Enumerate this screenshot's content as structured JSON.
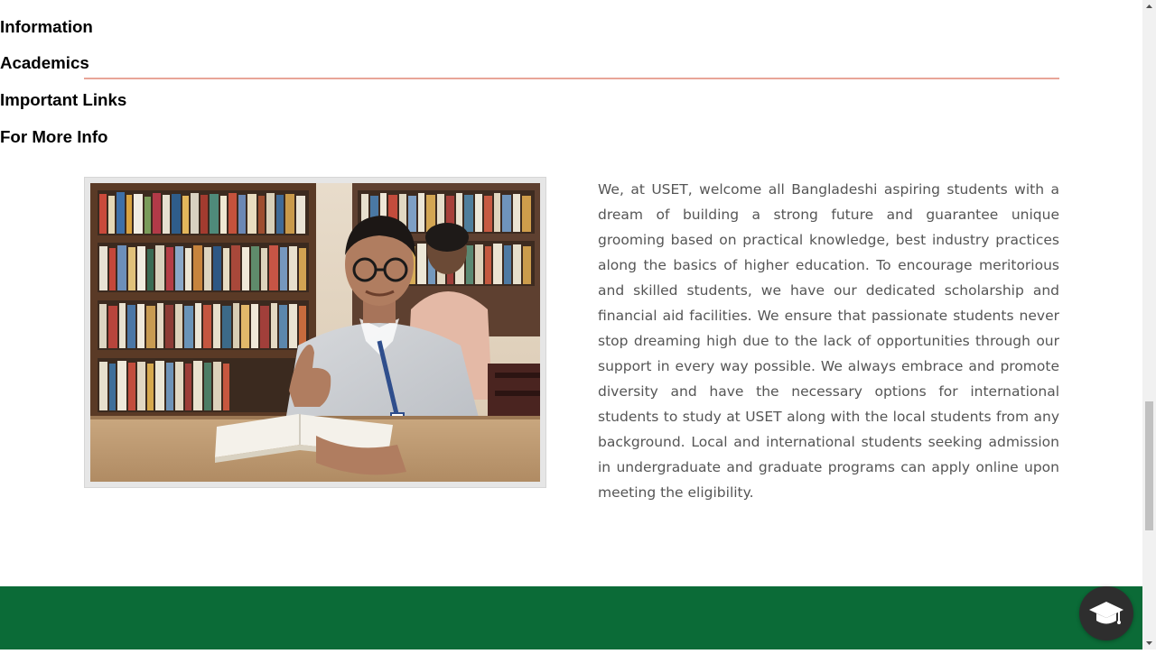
{
  "about": {
    "image_alt": "Student with book in library",
    "paragraph": "We, at USET, welcome all Bangladeshi aspiring students with a dream of building a strong future and guarantee unique grooming based on practical knowledge, best industry practices along the basics of higher education. To encourage meritorious and skilled students, we have our dedicated scholarship and financial aid facilities. We ensure that passionate students never stop dreaming high due to the lack of opportunities through our support in every way possible. We always embrace and promote diversity and have the necessary options for international students to study at USET along with the local students from any background. Local and international students seeking admission in undergraduate and graduate programs can apply online upon meeting the eligibility."
  },
  "footer": {
    "col1_title": "Information",
    "col2_title": "Academics",
    "col3_title": "Important Links",
    "col4_title": "For More Info"
  },
  "colors": {
    "divider": "#e8a598",
    "footer_bg": "#0b6b37",
    "body_text": "#555555",
    "floating_button": "#2e2e2e"
  },
  "icons": {
    "floating_button": "graduation-cap-icon",
    "scroll_up": "triangle-up-icon",
    "scroll_down": "triangle-down-icon"
  }
}
